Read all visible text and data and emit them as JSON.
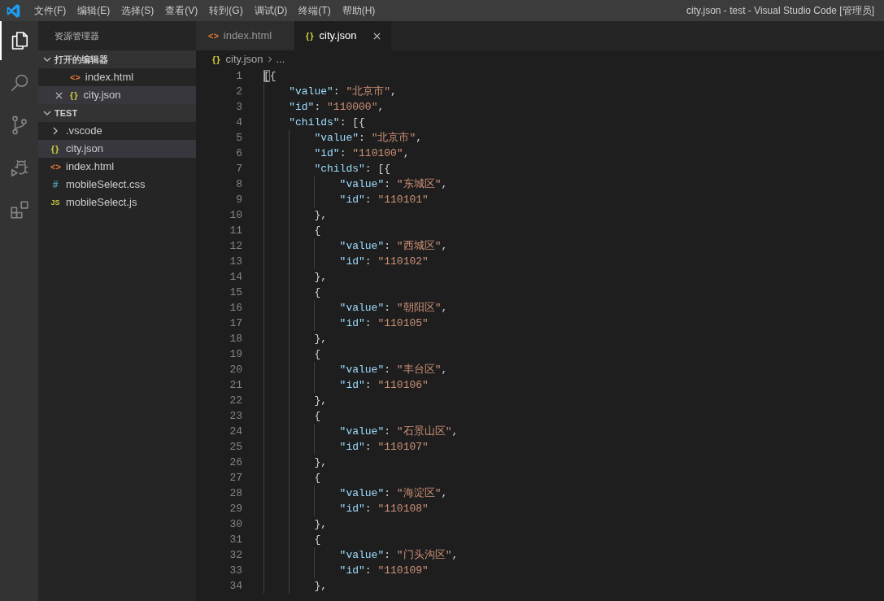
{
  "title_bar": {
    "menu": [
      "文件(F)",
      "编辑(E)",
      "选择(S)",
      "查看(V)",
      "转到(G)",
      "调试(D)",
      "终端(T)",
      "帮助(H)"
    ],
    "title": "city.json - test - Visual Studio Code [管理员]"
  },
  "activity_bar": [
    {
      "kind": "explorer",
      "selected": true
    },
    {
      "kind": "search",
      "selected": false
    },
    {
      "kind": "source-control",
      "selected": false
    },
    {
      "kind": "debug",
      "selected": false
    },
    {
      "kind": "extensions",
      "selected": false
    }
  ],
  "sidebar": {
    "title": "资源管理器",
    "sections": [
      {
        "kind": "open-editors",
        "title": "打开的编辑器",
        "expanded": true,
        "items": [
          {
            "kind": "html",
            "icon": "<>",
            "label": "index.html",
            "selected": false
          },
          {
            "kind": "json",
            "icon": "{}",
            "label": "city.json",
            "selected": true
          }
        ]
      },
      {
        "kind": "folder",
        "title": "TEST",
        "expanded": true,
        "items": [
          {
            "kind": "folder",
            "label": ".vscode",
            "expanded": false,
            "selected": false
          },
          {
            "kind": "json",
            "icon": "{}",
            "label": "city.json",
            "selected": true
          },
          {
            "kind": "html",
            "icon": "<>",
            "label": "index.html",
            "selected": false
          },
          {
            "kind": "css",
            "icon": "#",
            "label": "mobileSelect.css",
            "selected": false
          },
          {
            "kind": "js",
            "icon": "JS",
            "label": "mobileSelect.js",
            "selected": false
          }
        ]
      }
    ]
  },
  "tabs": [
    {
      "kind": "html",
      "icon": "<>",
      "label": "index.html",
      "selected": false
    },
    {
      "kind": "json",
      "icon": "{}",
      "label": "city.json",
      "selected": true
    }
  ],
  "breadcrumb": [
    {
      "kind": "json",
      "icon": "{}",
      "label": "city.json"
    },
    {
      "label": "..."
    }
  ],
  "editor": {
    "lines": [
      {
        "number": "1",
        "tokens": [
          {
            "kind": "bracket-match",
            "text": "["
          },
          {
            "kind": "punct",
            "text": "{"
          }
        ],
        "children": [
          {
            "number": "2",
            "tokens": [
              {
                "kind": "key",
                "text": "\"value\""
              },
              {
                "kind": "punct",
                "text": ": "
              },
              {
                "kind": "string",
                "text": "\"北京市\""
              },
              {
                "kind": "punct",
                "text": ","
              }
            ]
          },
          {
            "number": "3",
            "tokens": [
              {
                "kind": "key",
                "text": "\"id\""
              },
              {
                "kind": "punct",
                "text": ": "
              },
              {
                "kind": "string",
                "text": "\"110000\""
              },
              {
                "kind": "punct",
                "text": ","
              }
            ]
          },
          {
            "number": "4",
            "tokens": [
              {
                "kind": "key",
                "text": "\"childs\""
              },
              {
                "kind": "punct",
                "text": ": [{"
              }
            ],
            "children": [
              {
                "number": "5",
                "tokens": [
                  {
                    "kind": "key",
                    "text": "\"value\""
                  },
                  {
                    "kind": "punct",
                    "text": ": "
                  },
                  {
                    "kind": "string",
                    "text": "\"北京市\""
                  },
                  {
                    "kind": "punct",
                    "text": ","
                  }
                ]
              },
              {
                "number": "6",
                "tokens": [
                  {
                    "kind": "key",
                    "text": "\"id\""
                  },
                  {
                    "kind": "punct",
                    "text": ": "
                  },
                  {
                    "kind": "string",
                    "text": "\"110100\""
                  },
                  {
                    "kind": "punct",
                    "text": ","
                  }
                ]
              },
              {
                "number": "7",
                "tokens": [
                  {
                    "kind": "key",
                    "text": "\"childs\""
                  },
                  {
                    "kind": "punct",
                    "text": ": [{"
                  }
                ],
                "children": [
                  {
                    "number": "8",
                    "tokens": [
                      {
                        "kind": "key",
                        "text": "\"value\""
                      },
                      {
                        "kind": "punct",
                        "text": ": "
                      },
                      {
                        "kind": "string",
                        "text": "\"东城区\""
                      },
                      {
                        "kind": "punct",
                        "text": ","
                      }
                    ]
                  },
                  {
                    "number": "9",
                    "tokens": [
                      {
                        "kind": "key",
                        "text": "\"id\""
                      },
                      {
                        "kind": "punct",
                        "text": ": "
                      },
                      {
                        "kind": "string",
                        "text": "\"110101\""
                      }
                    ]
                  }
                ]
              },
              {
                "number": "10",
                "tokens": [
                  {
                    "kind": "punct",
                    "text": "},"
                  }
                ]
              },
              {
                "number": "11",
                "tokens": [
                  {
                    "kind": "punct",
                    "text": "{"
                  }
                ],
                "children": [
                  {
                    "number": "12",
                    "tokens": [
                      {
                        "kind": "key",
                        "text": "\"value\""
                      },
                      {
                        "kind": "punct",
                        "text": ": "
                      },
                      {
                        "kind": "string",
                        "text": "\"西城区\""
                      },
                      {
                        "kind": "punct",
                        "text": ","
                      }
                    ]
                  },
                  {
                    "number": "13",
                    "tokens": [
                      {
                        "kind": "key",
                        "text": "\"id\""
                      },
                      {
                        "kind": "punct",
                        "text": ": "
                      },
                      {
                        "kind": "string",
                        "text": "\"110102\""
                      }
                    ]
                  }
                ]
              },
              {
                "number": "14",
                "tokens": [
                  {
                    "kind": "punct",
                    "text": "},"
                  }
                ]
              },
              {
                "number": "15",
                "tokens": [
                  {
                    "kind": "punct",
                    "text": "{"
                  }
                ],
                "children": [
                  {
                    "number": "16",
                    "tokens": [
                      {
                        "kind": "key",
                        "text": "\"value\""
                      },
                      {
                        "kind": "punct",
                        "text": ": "
                      },
                      {
                        "kind": "string",
                        "text": "\"朝阳区\""
                      },
                      {
                        "kind": "punct",
                        "text": ","
                      }
                    ]
                  },
                  {
                    "number": "17",
                    "tokens": [
                      {
                        "kind": "key",
                        "text": "\"id\""
                      },
                      {
                        "kind": "punct",
                        "text": ": "
                      },
                      {
                        "kind": "string",
                        "text": "\"110105\""
                      }
                    ]
                  }
                ]
              },
              {
                "number": "18",
                "tokens": [
                  {
                    "kind": "punct",
                    "text": "},"
                  }
                ]
              },
              {
                "number": "19",
                "tokens": [
                  {
                    "kind": "punct",
                    "text": "{"
                  }
                ],
                "children": [
                  {
                    "number": "20",
                    "tokens": [
                      {
                        "kind": "key",
                        "text": "\"value\""
                      },
                      {
                        "kind": "punct",
                        "text": ": "
                      },
                      {
                        "kind": "string",
                        "text": "\"丰台区\""
                      },
                      {
                        "kind": "punct",
                        "text": ","
                      }
                    ]
                  },
                  {
                    "number": "21",
                    "tokens": [
                      {
                        "kind": "key",
                        "text": "\"id\""
                      },
                      {
                        "kind": "punct",
                        "text": ": "
                      },
                      {
                        "kind": "string",
                        "text": "\"110106\""
                      }
                    ]
                  }
                ]
              },
              {
                "number": "22",
                "tokens": [
                  {
                    "kind": "punct",
                    "text": "},"
                  }
                ]
              },
              {
                "number": "23",
                "tokens": [
                  {
                    "kind": "punct",
                    "text": "{"
                  }
                ],
                "children": [
                  {
                    "number": "24",
                    "tokens": [
                      {
                        "kind": "key",
                        "text": "\"value\""
                      },
                      {
                        "kind": "punct",
                        "text": ": "
                      },
                      {
                        "kind": "string",
                        "text": "\"石景山区\""
                      },
                      {
                        "kind": "punct",
                        "text": ","
                      }
                    ]
                  },
                  {
                    "number": "25",
                    "tokens": [
                      {
                        "kind": "key",
                        "text": "\"id\""
                      },
                      {
                        "kind": "punct",
                        "text": ": "
                      },
                      {
                        "kind": "string",
                        "text": "\"110107\""
                      }
                    ]
                  }
                ]
              },
              {
                "number": "26",
                "tokens": [
                  {
                    "kind": "punct",
                    "text": "},"
                  }
                ]
              },
              {
                "number": "27",
                "tokens": [
                  {
                    "kind": "punct",
                    "text": "{"
                  }
                ],
                "children": [
                  {
                    "number": "28",
                    "tokens": [
                      {
                        "kind": "key",
                        "text": "\"value\""
                      },
                      {
                        "kind": "punct",
                        "text": ": "
                      },
                      {
                        "kind": "string",
                        "text": "\"海淀区\""
                      },
                      {
                        "kind": "punct",
                        "text": ","
                      }
                    ]
                  },
                  {
                    "number": "29",
                    "tokens": [
                      {
                        "kind": "key",
                        "text": "\"id\""
                      },
                      {
                        "kind": "punct",
                        "text": ": "
                      },
                      {
                        "kind": "string",
                        "text": "\"110108\""
                      }
                    ]
                  }
                ]
              },
              {
                "number": "30",
                "tokens": [
                  {
                    "kind": "punct",
                    "text": "},"
                  }
                ]
              },
              {
                "number": "31",
                "tokens": [
                  {
                    "kind": "punct",
                    "text": "{"
                  }
                ],
                "children": [
                  {
                    "number": "32",
                    "tokens": [
                      {
                        "kind": "key",
                        "text": "\"value\""
                      },
                      {
                        "kind": "punct",
                        "text": ": "
                      },
                      {
                        "kind": "string",
                        "text": "\"门头沟区\""
                      },
                      {
                        "kind": "punct",
                        "text": ","
                      }
                    ]
                  },
                  {
                    "number": "33",
                    "tokens": [
                      {
                        "kind": "key",
                        "text": "\"id\""
                      },
                      {
                        "kind": "punct",
                        "text": ": "
                      },
                      {
                        "kind": "string",
                        "text": "\"110109\""
                      }
                    ]
                  }
                ]
              },
              {
                "number": "34",
                "tokens": [
                  {
                    "kind": "punct",
                    "text": "},"
                  }
                ]
              }
            ]
          }
        ]
      }
    ]
  }
}
